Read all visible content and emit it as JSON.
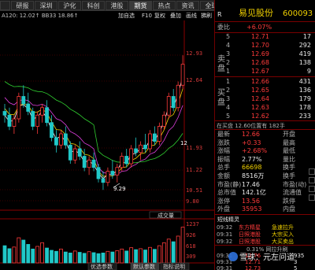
{
  "tabs": [
    "",
    "研报",
    "深圳",
    "沪化",
    "科创",
    "港股",
    "期货",
    "热点",
    "资讯",
    "全球",
    "选股",
    "策略",
    "动态",
    "推荐"
  ],
  "toolbar": {
    "info": "A120: 12.02↑  BB33  18.86↑",
    "buttons": [
      "加自选",
      "F10",
      "复权",
      "叠加",
      "画线",
      "拂刷"
    ]
  },
  "chart": {
    "price_labels": [
      "12.93",
      "12.64",
      "11.93",
      "11.22",
      "10.51",
      "9.80"
    ],
    "high_marker": "12",
    "low_marker": "9.29",
    "volume_labels": [
      "1237",
      "926",
      "618",
      "309"
    ],
    "indicator_button": "成交量",
    "bottom_tabs": [
      "优选参数",
      "默认参数",
      "指标说明"
    ]
  },
  "quote": {
    "title_label": "R",
    "name": "易见股份",
    "code": "600093",
    "weibi_label": "委比",
    "weibi": "+6.07%",
    "sell_label": "卖盘",
    "buy_label": "买盘",
    "sells": [
      {
        "n": "5",
        "price": "12.71",
        "vol": "17"
      },
      {
        "n": "4",
        "price": "12.70",
        "vol": "292"
      },
      {
        "n": "3",
        "price": "12.69",
        "vol": "419"
      },
      {
        "n": "2",
        "price": "12.68",
        "vol": "138"
      },
      {
        "n": "1",
        "price": "12.67",
        "vol": "9"
      }
    ],
    "buys": [
      {
        "n": "1",
        "price": "12.66",
        "vol": "431"
      },
      {
        "n": "2",
        "price": "12.65",
        "vol": "136"
      },
      {
        "n": "3",
        "price": "12.64",
        "vol": "179"
      },
      {
        "n": "4",
        "price": "12.63",
        "vol": "178"
      },
      {
        "n": "5",
        "price": "12.62",
        "vol": "233"
      }
    ],
    "pending": "在买盘 12.60位置有 182手 ",
    "stats": [
      [
        "最新",
        "12.66",
        "开盘",
        ""
      ],
      [
        "涨跌",
        "+0.33",
        "最高",
        ""
      ],
      [
        "涨幅",
        "+2.68%",
        "最低",
        ""
      ],
      [
        "振幅",
        "2.77%",
        "量比",
        ""
      ],
      [
        "总手",
        "66698",
        "换手",
        ""
      ],
      [
        "金额",
        "8516万",
        "换手",
        ""
      ],
      [
        "市盈(静)",
        "17.46",
        "市盈(动)",
        ""
      ],
      [
        "总市值",
        "142.1亿",
        "流通值",
        ""
      ],
      [
        "涨停",
        "13.56",
        "跌停",
        ""
      ],
      [
        "外盘",
        "35953",
        "内盘",
        ""
      ]
    ],
    "news_header": "短线精灵",
    "news": [
      {
        "time": "09:32",
        "tag": "东方精星",
        "text": "急速拉升"
      },
      {
        "time": "09:31",
        "tag": "日照港股",
        "text": "大宗买入"
      },
      {
        "time": "09:32",
        "tag": "日照港股",
        "text": "大买卖出"
      }
    ],
    "ticks_header": "0.31%    网拉升刷",
    "ticks": [
      {
        "time": "09:31",
        "price": "12.76",
        "vol": "935"
      },
      {
        "time": "09:31",
        "price": "12.71",
        "vol": "3"
      },
      {
        "time": "09:31",
        "price": "12.73",
        "vol": "5"
      }
    ]
  },
  "watermark": "雪球：元左问道"
}
